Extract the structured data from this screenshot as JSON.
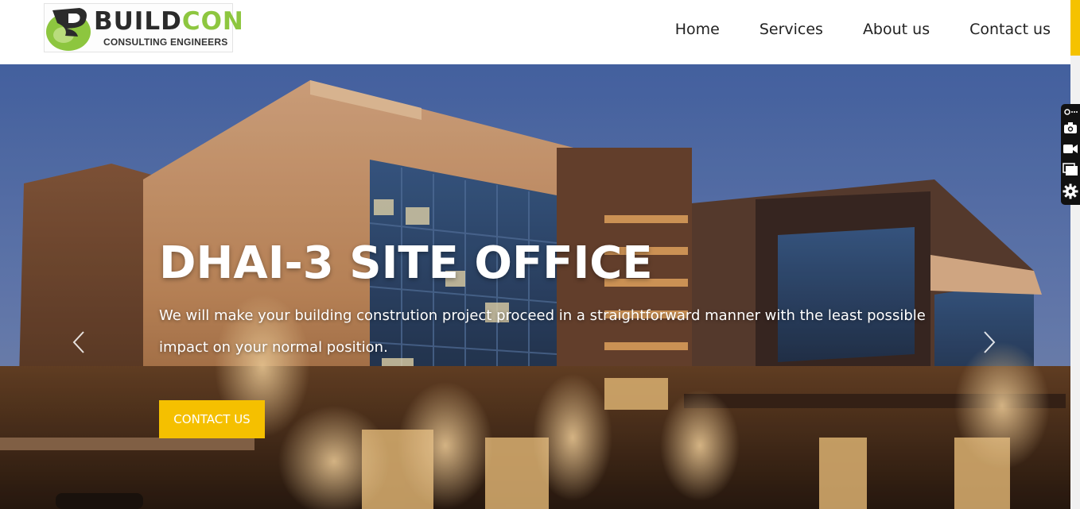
{
  "brand": {
    "name_part1": "BUILD",
    "name_part2": "CON",
    "tagline": "CONSULTING ENGINEERS",
    "colors": {
      "dark": "#2b2b2b",
      "green": "#8dc63f"
    }
  },
  "nav": {
    "items": [
      {
        "label": "Home"
      },
      {
        "label": "Services"
      },
      {
        "label": "About us"
      },
      {
        "label": "Contact us"
      }
    ]
  },
  "hero": {
    "title": "DHAI-3 SITE OFFICE",
    "text": "We will make your building constrution project proceed in a straightforward manner with the least possible impact on your normal position.",
    "button_label": "CONTACT US",
    "prev_icon": "chevron-left-icon",
    "next_icon": "chevron-right-icon"
  },
  "toolbar": {
    "icons": [
      "link-icon",
      "camera-icon",
      "video-icon",
      "windows-icon",
      "gear-icon"
    ]
  },
  "colors": {
    "accent": "#f5c000",
    "sky": "#4f6aa8",
    "header_bg": "#ffffff",
    "toolbar_bg": "#111111"
  }
}
